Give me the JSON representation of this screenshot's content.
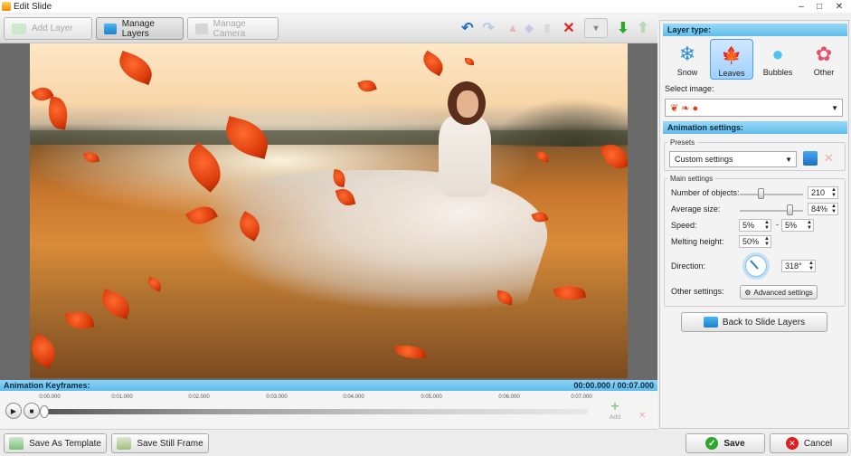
{
  "window": {
    "title": "Edit Slide",
    "minimize": "–",
    "maximize": "□",
    "close": "✕"
  },
  "toolbar": {
    "add_layer": "Add Layer",
    "manage_layers": "Manage Layers",
    "manage_camera": "Manage Camera",
    "undo_glyph": "↶",
    "redo_glyph": "↷",
    "delete_glyph": "✕",
    "more_glyph": "▾",
    "move_down_glyph": "⬇",
    "move_up_glyph": "⬆"
  },
  "colors": {
    "accent": "#5cbbe8",
    "selected": "#9fd0ff",
    "delete_red": "#e02020",
    "move_green": "#2ea62e",
    "leaf": "#e24a14"
  },
  "keyframes": {
    "header": "Animation Keyframes:",
    "time": "00:00.000 / 00:07.000",
    "ticks": [
      "0:00.000",
      "0:01.000",
      "0:02.000",
      "0:03.000",
      "0:04.000",
      "0:05.000",
      "0:06.000",
      "0:07.000"
    ],
    "play_glyph": "▶",
    "stop_glyph": "■",
    "add_glyph": "+",
    "add_label": "Add",
    "delete_glyph": "✕"
  },
  "footer": {
    "save_template": "Save As Template",
    "save_still": "Save Still Frame",
    "save": "Save",
    "cancel": "Cancel"
  },
  "panel": {
    "layer_type_header": "Layer type:",
    "types": [
      {
        "label": "Snow",
        "glyph": "❄",
        "icon": "snowflake-icon"
      },
      {
        "label": "Leaves",
        "glyph": "🍁",
        "icon": "leaf-icon"
      },
      {
        "label": "Bubbles",
        "glyph": "●",
        "icon": "bubble-icon"
      },
      {
        "label": "Other",
        "glyph": "✿",
        "icon": "other-shapes-icon"
      }
    ],
    "selected_type": "Leaves",
    "select_image_label": "Select image:",
    "select_image_arrow": "▼",
    "animation_header": "Animation settings:",
    "presets_title": "Presets",
    "preset_value": "Custom settings",
    "main_settings_title": "Main settings",
    "number_of_objects_label": "Number of objects:",
    "number_of_objects": "210",
    "average_size_label": "Average size:",
    "average_size": "84%",
    "speed_label": "Speed:",
    "speed_min": "5%",
    "speed_max": "5%",
    "range_dash": "-",
    "melting_label": "Melting height:",
    "melting_height": "50%",
    "direction_label": "Direction:",
    "direction": "318°",
    "other_settings_label": "Other settings:",
    "advanced_settings": "Advanced settings",
    "back_button": "Back to Slide Layers",
    "spin_up": "▲",
    "spin_down": "▼"
  }
}
